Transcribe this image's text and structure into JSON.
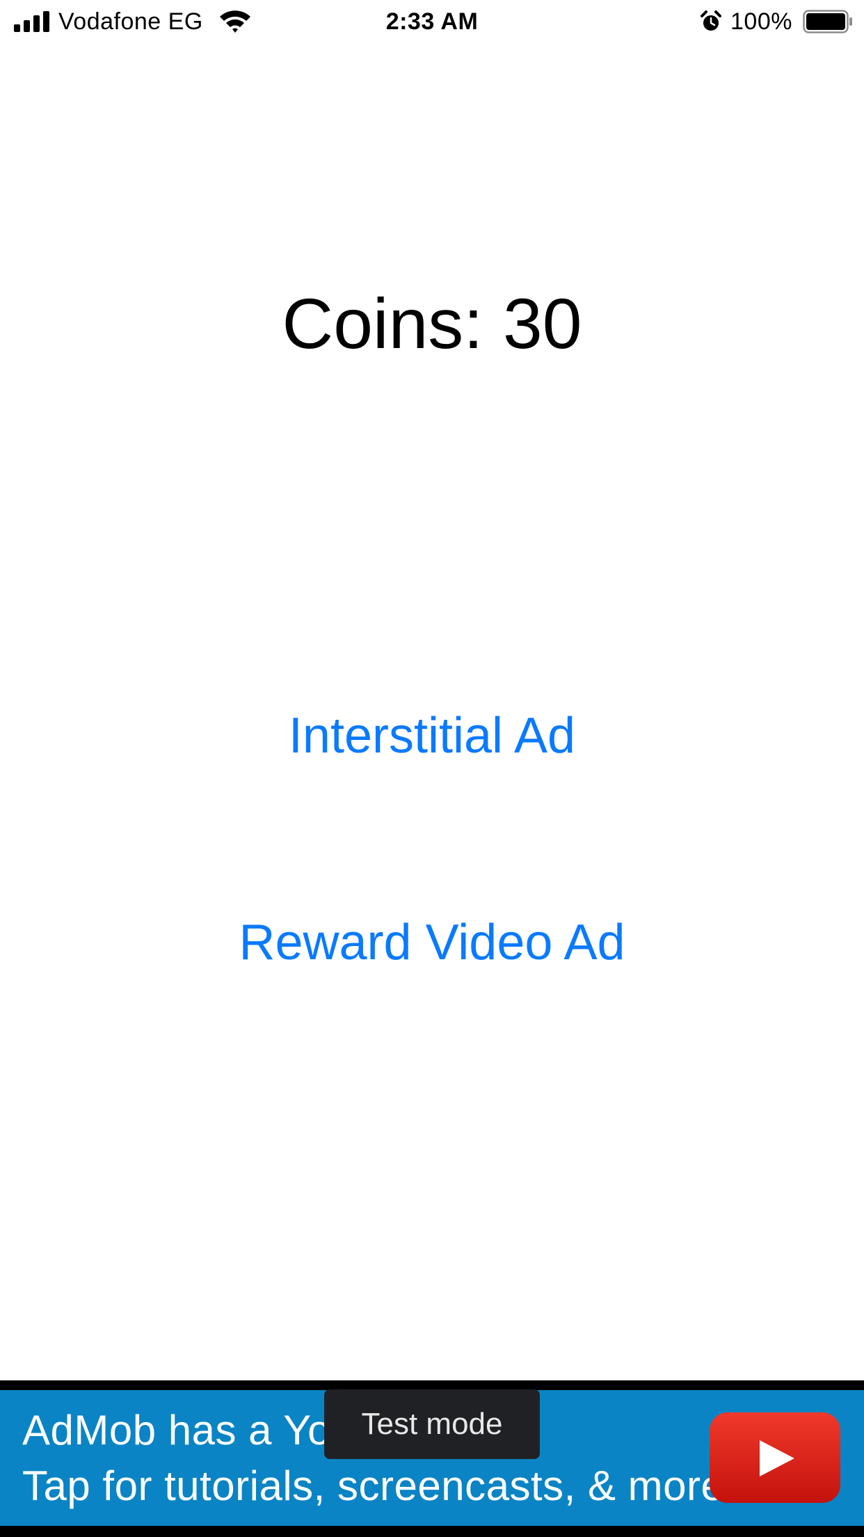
{
  "status_bar": {
    "carrier": "Vodafone EG",
    "time": "2:33 AM",
    "battery_percent": "100%",
    "signal_bars": 4,
    "battery_level": 1.0,
    "icons": [
      "signal-icon",
      "wifi-icon",
      "alarm-icon",
      "battery-icon"
    ]
  },
  "main": {
    "coins_label": "Coins: 30",
    "interstitial_button": "Interstitial Ad",
    "reward_button": "Reward Video Ad"
  },
  "ad_banner": {
    "line1": "AdMob has a You",
    "line2": "Tap for tutorials, screencasts, & more.",
    "badge": "Test mode",
    "icon": "youtube-play-icon"
  },
  "colors": {
    "link": "#0a7aff",
    "ad_background": "#0a84c4",
    "youtube_red": "#e62117",
    "badge_background": "#202124"
  }
}
